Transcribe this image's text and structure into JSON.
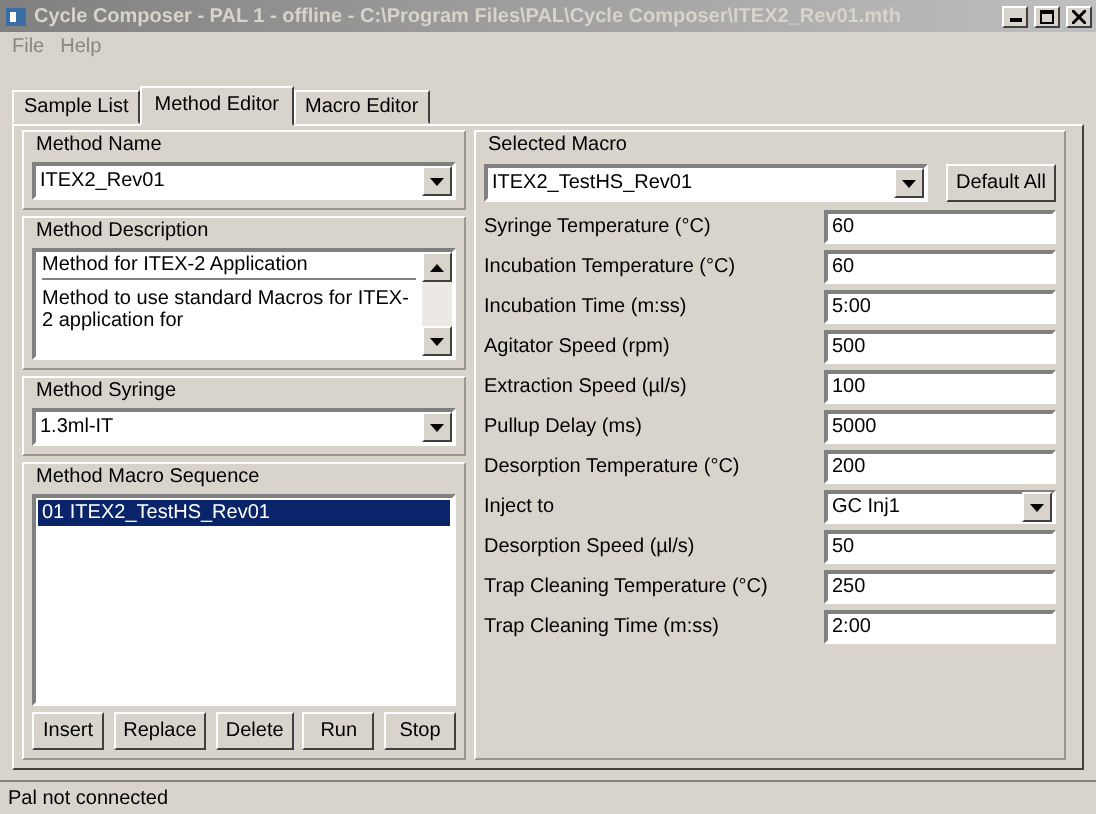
{
  "window": {
    "title": "Cycle Composer - PAL 1 - offline - C:\\Program Files\\PAL\\Cycle Composer\\ITEX2_Rev01.mth",
    "active": false
  },
  "menu": [
    "File",
    "Help"
  ],
  "tabs": [
    {
      "label": "Sample List",
      "selected": false
    },
    {
      "label": "Method Editor",
      "selected": true
    },
    {
      "label": "Macro Editor",
      "selected": false
    }
  ],
  "method_name": {
    "label": "Method Name",
    "value": "ITEX2_Rev01"
  },
  "method_description": {
    "label": "Method Description",
    "title": "Method for ITEX-2 Application",
    "text": "Method to use standard Macros for ITEX-2 application for"
  },
  "method_syringe": {
    "label": "Method Syringe",
    "value": "1.3ml-IT"
  },
  "macro_sequence": {
    "label": "Method Macro Sequence",
    "items": [
      {
        "text": "01 ITEX2_TestHS_Rev01",
        "selected": true
      }
    ],
    "buttons": [
      "Insert",
      "Replace",
      "Delete",
      "Run",
      "Stop"
    ]
  },
  "selected_macro": {
    "label": "Selected Macro",
    "value": "ITEX2_TestHS_Rev01",
    "default_button": "Default All",
    "params": [
      {
        "kind": "text",
        "label": "Syringe Temperature  (°C)",
        "value": "60"
      },
      {
        "kind": "text",
        "label": "Incubation Temperature  (°C)",
        "value": "60"
      },
      {
        "kind": "text",
        "label": "Incubation Time  (m:ss)",
        "value": "5:00"
      },
      {
        "kind": "text",
        "label": "Agitator Speed  (rpm)",
        "value": "500"
      },
      {
        "kind": "text",
        "label": "Extraction Speed  (µl/s)",
        "value": "100"
      },
      {
        "kind": "text",
        "label": "Pullup Delay  (ms)",
        "value": "5000"
      },
      {
        "kind": "text",
        "label": "Desorption Temperature  (°C)",
        "value": "200"
      },
      {
        "kind": "select",
        "label": "Inject to",
        "value": "GC Inj1"
      },
      {
        "kind": "text",
        "label": "Desorption Speed  (µl/s)",
        "value": "50"
      },
      {
        "kind": "text",
        "label": "Trap Cleaning Temperature  (°C)",
        "value": "250"
      },
      {
        "kind": "text",
        "label": "Trap Cleaning Time  (m:ss)",
        "value": "2:00"
      }
    ]
  },
  "status_bar": "Pal not connected"
}
